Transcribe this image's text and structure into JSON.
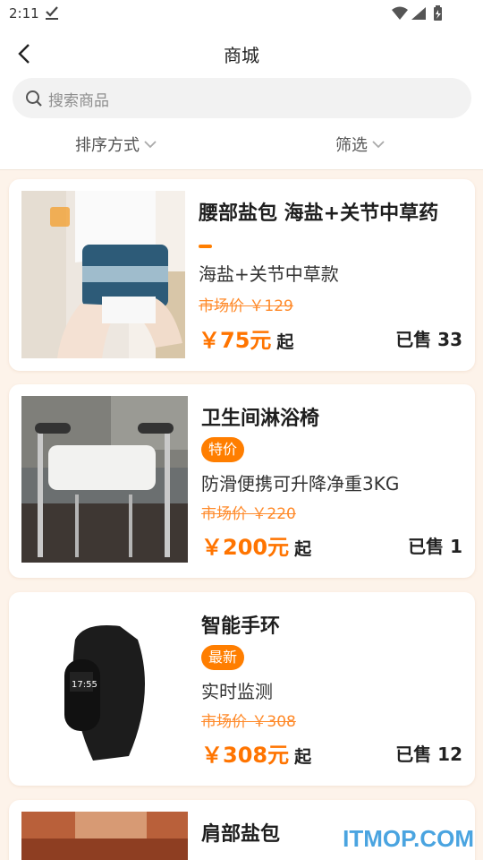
{
  "status": {
    "time": "2:11"
  },
  "header": {
    "title": "商城"
  },
  "search": {
    "placeholder": "搜索商品"
  },
  "filters": {
    "sort": "排序方式",
    "filter": "筛选"
  },
  "products": [
    {
      "name": "腰部盐包 海盐+关节中草药",
      "tag": "",
      "desc": "海盐+关节中草款",
      "market_price": "市场价 ￥129",
      "price": "￥75元",
      "price_unit": "起",
      "sold": "已售 33"
    },
    {
      "name": "卫生间淋浴椅",
      "tag": "特价",
      "desc": "防滑便携可升降净重3KG",
      "market_price": "市场价 ￥220",
      "price": "￥200元",
      "price_unit": "起",
      "sold": "已售 1"
    },
    {
      "name": "智能手环",
      "tag": "最新",
      "desc": "实时监测",
      "market_price": "市场价 ￥308",
      "price": "￥308元",
      "price_unit": "起",
      "sold": "已售 12"
    },
    {
      "name": "肩部盐包"
    }
  ],
  "band_time": "17:55",
  "watermark": "ITMOP.COM",
  "colors": {
    "accent": "#ff7e00",
    "background": "#fdf3ea"
  }
}
